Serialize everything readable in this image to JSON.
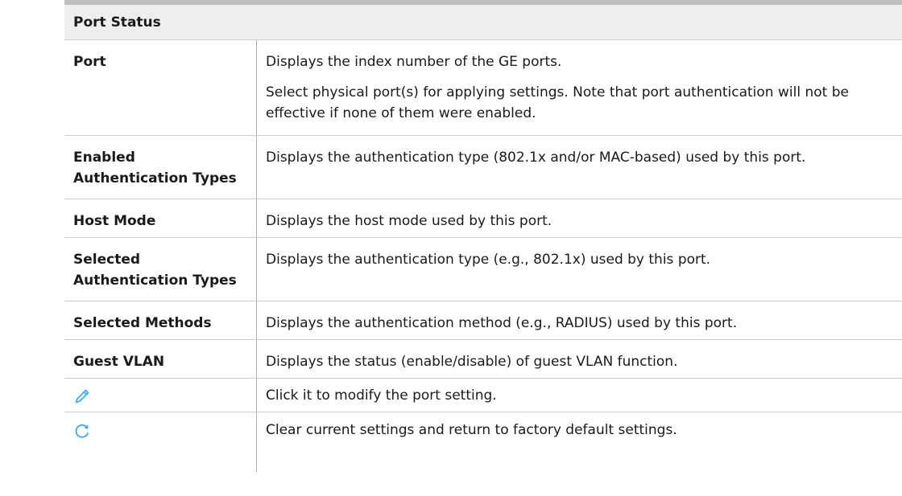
{
  "section": {
    "title": "Port Status"
  },
  "rows": [
    {
      "term": "Port",
      "description": [
        "Displays the index number of the GE ports.",
        "Select physical port(s) for applying settings. Note that port authentication will not be effective if none of them were enabled."
      ]
    },
    {
      "term": "Enabled Authentication Types",
      "description": [
        "Displays the authentication type (802.1x and/or MAC-based) used by this port."
      ]
    },
    {
      "term": "Host Mode",
      "description": [
        "Displays the host mode used by this port."
      ]
    },
    {
      "term": "Selected Authentication Types",
      "description": [
        "Displays the authentication type (e.g., 802.1x) used by this port."
      ]
    },
    {
      "term": "Selected Methods",
      "description": [
        "Displays the authentication method (e.g., RADIUS) used by this port."
      ]
    },
    {
      "term": "Guest VLAN",
      "description": [
        "Displays the status (enable/disable) of guest VLAN function."
      ]
    },
    {
      "icon": "pencil-edit-icon",
      "description": [
        "Click it to modify the port setting."
      ]
    },
    {
      "icon": "refresh-icon",
      "description": [
        "Clear current settings and return to factory default settings."
      ]
    }
  ],
  "colors": {
    "icon_blue": "#36a9f0",
    "header_bg": "#eeeeee",
    "rule": "#bfbfbf"
  }
}
